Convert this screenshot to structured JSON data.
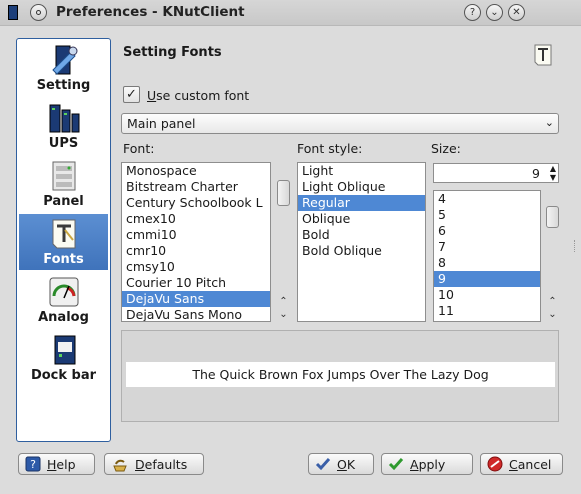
{
  "window": {
    "title": "Preferences - KNutClient"
  },
  "sidebar": {
    "items": [
      {
        "label": "Setting"
      },
      {
        "label": "UPS"
      },
      {
        "label": "Panel"
      },
      {
        "label": "Fonts"
      },
      {
        "label": "Analog"
      },
      {
        "label": "Dock bar"
      }
    ],
    "selected": "Fonts"
  },
  "page": {
    "heading": "Setting Fonts",
    "custom_font_label": "Use custom font",
    "custom_font_checked": true,
    "target_select": "Main panel",
    "font_label": "Font:",
    "style_label": "Font style:",
    "size_label": "Size:",
    "fonts": [
      "Monospace",
      "Bitstream Charter",
      "Century Schoolbook L",
      "cmex10",
      "cmmi10",
      "cmr10",
      "cmsy10",
      "Courier 10 Pitch",
      "DejaVu Sans",
      "DejaVu Sans Mono"
    ],
    "selected_font": "DejaVu Sans",
    "styles": [
      "Light",
      "Light Oblique",
      "Regular",
      "Oblique",
      "Bold",
      "Bold Oblique"
    ],
    "selected_style": "Regular",
    "size_value": "9",
    "sizes": [
      "4",
      "5",
      "6",
      "7",
      "8",
      "9",
      "10",
      "11"
    ],
    "selected_size": "9",
    "preview_text": "The Quick Brown Fox Jumps Over The Lazy Dog"
  },
  "buttons": {
    "help": "Help",
    "defaults": "Defaults",
    "ok": "OK",
    "apply": "Apply",
    "cancel": "Cancel"
  },
  "colors": {
    "selection": "#4e88d4",
    "sidebar_border": "#2f5f9f"
  }
}
